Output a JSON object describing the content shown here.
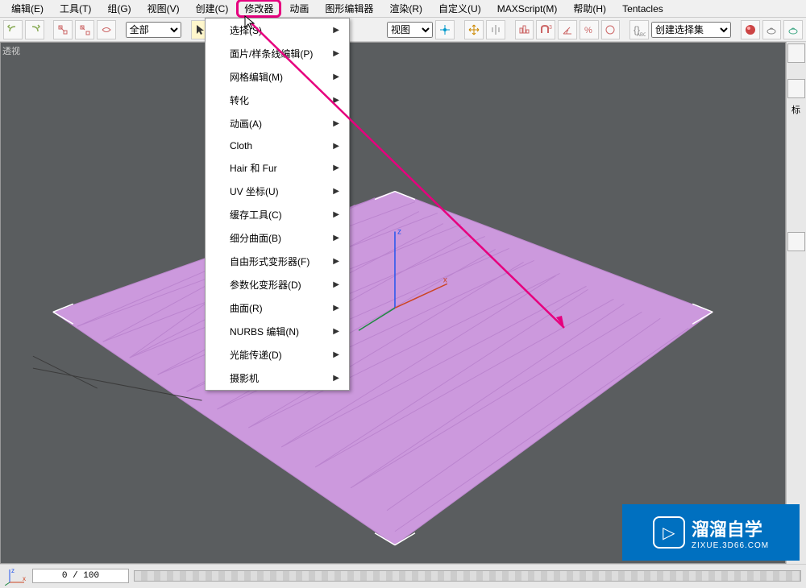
{
  "menubar": {
    "items": [
      "编辑(E)",
      "工具(T)",
      "组(G)",
      "视图(V)",
      "创建(C)",
      "修改器",
      "动画",
      "图形编辑器",
      "渲染(R)",
      "自定义(U)",
      "MAXScript(M)",
      "帮助(H)",
      "Tentacles"
    ],
    "active_index": 5
  },
  "toolbar": {
    "selection_set_label": "全部",
    "view_label": "视图",
    "create_set_label": "创建选择集"
  },
  "dropdown": {
    "items": [
      {
        "label": "选择(S)",
        "arrow": true
      },
      {
        "label": "面片/样条线编辑(P)",
        "arrow": true
      },
      {
        "label": "网格编辑(M)",
        "arrow": true
      },
      {
        "label": "转化",
        "arrow": true
      },
      {
        "label": "动画(A)",
        "arrow": true
      },
      {
        "label": "Cloth",
        "arrow": true
      },
      {
        "label": "Hair 和 Fur",
        "arrow": true
      },
      {
        "label": "UV 坐标(U)",
        "arrow": true
      },
      {
        "label": "缓存工具(C)",
        "arrow": true
      },
      {
        "label": "细分曲面(B)",
        "arrow": true
      },
      {
        "label": "自由形式变形器(F)",
        "arrow": true
      },
      {
        "label": "参数化变形器(D)",
        "arrow": true
      },
      {
        "label": "曲面(R)",
        "arrow": true
      },
      {
        "label": "NURBS 编辑(N)",
        "arrow": true
      },
      {
        "label": "光能传递(D)",
        "arrow": true
      },
      {
        "label": "摄影机",
        "arrow": true
      }
    ]
  },
  "viewport": {
    "label": "透视",
    "scene": {
      "object": "plane",
      "grid_color": "#c690d6",
      "axis_z_color": "#0055ff",
      "axis_x_color": "#cc3300",
      "axis_labels": {
        "x": "x",
        "z": "z"
      }
    }
  },
  "right_panel": {
    "mode_label": "标"
  },
  "statusbar": {
    "timeline": "0 / 100",
    "axis_labels": {
      "x": "x",
      "z": "z"
    }
  },
  "watermark": {
    "title": "溜溜自学",
    "subtitle": "ZIXUE.3D66.COM",
    "icon_glyph": "▷"
  },
  "annotation": {
    "color": "#e6007e"
  }
}
